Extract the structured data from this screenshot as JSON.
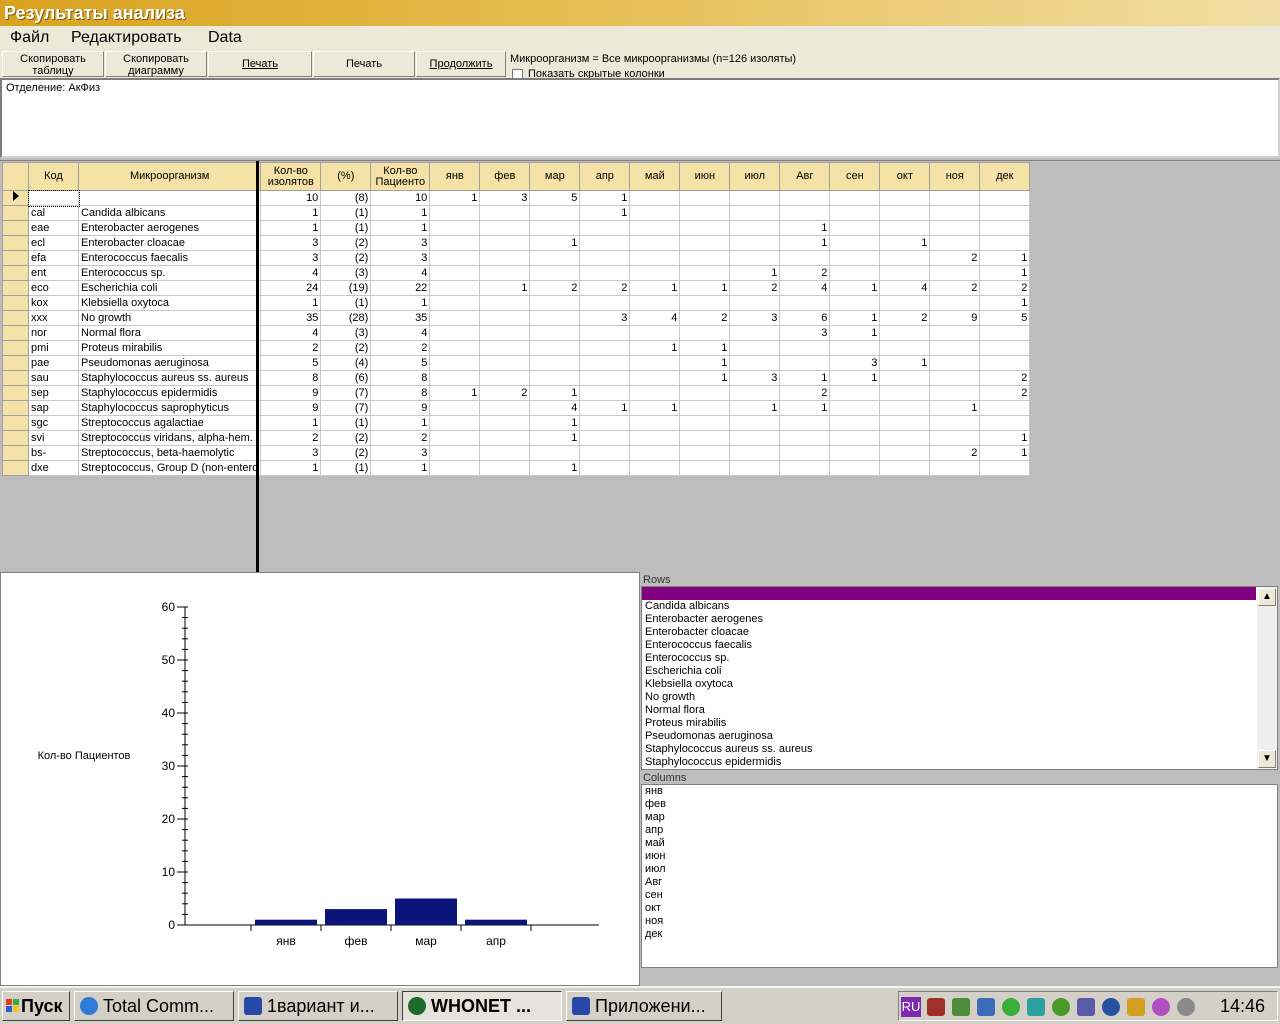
{
  "window": {
    "title": "Результаты анализа"
  },
  "menu": [
    "Файл",
    "Редактировать",
    "Data"
  ],
  "toolbar": {
    "copy_table": [
      "Скопировать",
      "таблицу"
    ],
    "copy_chart": [
      "Скопировать",
      "диаграмму"
    ],
    "print1": "Печать",
    "print2": "Печать",
    "continue": "Продолжить",
    "filter_info": "Микроорганизм = Все микроорганизмы   (n=126 изоляты)",
    "show_hidden_label": "Показать скрытые колонки",
    "show_hidden_checked": false
  },
  "department": "Отделение:   АкФиз",
  "table": {
    "headers": [
      "Код",
      "Микроорганизм",
      "Кол-во изолятов",
      "(%)",
      "Кол-во Пациенто",
      "янв",
      "фев",
      "мар",
      "апр",
      "май",
      "июн",
      "июл",
      "Авг",
      "сен",
      "окт",
      "ноя",
      "дек"
    ],
    "rows": [
      [
        "",
        "",
        "10",
        "(8)",
        "10",
        "1",
        "3",
        "5",
        "1",
        "",
        "",
        "",
        "",
        "",
        "",
        "",
        ""
      ],
      [
        "cal",
        "Candida albicans",
        "1",
        "(1)",
        "1",
        "",
        "",
        "",
        "1",
        "",
        "",
        "",
        "",
        "",
        "",
        "",
        ""
      ],
      [
        "eae",
        "Enterobacter aerogenes",
        "1",
        "(1)",
        "1",
        "",
        "",
        "",
        "",
        "",
        "",
        "",
        "1",
        "",
        "",
        "",
        ""
      ],
      [
        "ecl",
        "Enterobacter cloacae",
        "3",
        "(2)",
        "3",
        "",
        "",
        "1",
        "",
        "",
        "",
        "",
        "1",
        "",
        "1",
        "",
        ""
      ],
      [
        "efa",
        "Enterococcus faecalis",
        "3",
        "(2)",
        "3",
        "",
        "",
        "",
        "",
        "",
        "",
        "",
        "",
        "",
        "",
        "2",
        "1"
      ],
      [
        "ent",
        "Enterococcus sp.",
        "4",
        "(3)",
        "4",
        "",
        "",
        "",
        "",
        "",
        "",
        "1",
        "2",
        "",
        "",
        "",
        "1"
      ],
      [
        "eco",
        "Escherichia coli",
        "24",
        "(19)",
        "22",
        "",
        "1",
        "2",
        "2",
        "1",
        "1",
        "2",
        "4",
        "1",
        "4",
        "2",
        "2"
      ],
      [
        "kox",
        "Klebsiella oxytoca",
        "1",
        "(1)",
        "1",
        "",
        "",
        "",
        "",
        "",
        "",
        "",
        "",
        "",
        "",
        "",
        "1"
      ],
      [
        "xxx",
        "No growth",
        "35",
        "(28)",
        "35",
        "",
        "",
        "",
        "3",
        "4",
        "2",
        "3",
        "6",
        "1",
        "2",
        "9",
        "5"
      ],
      [
        "nor",
        "Normal flora",
        "4",
        "(3)",
        "4",
        "",
        "",
        "",
        "",
        "",
        "",
        "",
        "3",
        "1",
        "",
        "",
        ""
      ],
      [
        "pmi",
        "Proteus mirabilis",
        "2",
        "(2)",
        "2",
        "",
        "",
        "",
        "",
        "1",
        "1",
        "",
        "",
        "",
        "",
        "",
        ""
      ],
      [
        "pae",
        "Pseudomonas aeruginosa",
        "5",
        "(4)",
        "5",
        "",
        "",
        "",
        "",
        "",
        "1",
        "",
        "",
        "3",
        "1",
        "",
        ""
      ],
      [
        "sau",
        "Staphylococcus aureus ss. aureus",
        "8",
        "(6)",
        "8",
        "",
        "",
        "",
        "",
        "",
        "1",
        "3",
        "1",
        "1",
        "",
        "",
        "2"
      ],
      [
        "sep",
        "Staphylococcus epidermidis",
        "9",
        "(7)",
        "8",
        "1",
        "2",
        "1",
        "",
        "",
        "",
        "",
        "2",
        "",
        "",
        "",
        "2"
      ],
      [
        "sap",
        "Staphylococcus saprophyticus",
        "9",
        "(7)",
        "9",
        "",
        "",
        "4",
        "1",
        "1",
        "",
        "1",
        "1",
        "",
        "",
        "1",
        ""
      ],
      [
        "sgc",
        "Streptococcus agalactiae",
        "1",
        "(1)",
        "1",
        "",
        "",
        "1",
        "",
        "",
        "",
        "",
        "",
        "",
        "",
        "",
        ""
      ],
      [
        "svi",
        "Streptococcus viridans, alpha-hem.",
        "2",
        "(2)",
        "2",
        "",
        "",
        "1",
        "",
        "",
        "",
        "",
        "",
        "",
        "",
        "",
        "1"
      ],
      [
        "bs-",
        "Streptococcus, beta-haemolytic",
        "3",
        "(2)",
        "3",
        "",
        "",
        "",
        "",
        "",
        "",
        "",
        "",
        "",
        "",
        "2",
        "1"
      ],
      [
        "dxe",
        "Streptococcus, Group D (non-entero",
        "1",
        "(1)",
        "1",
        "",
        "",
        "1",
        "",
        "",
        "",
        "",
        "",
        "",
        "",
        "",
        ""
      ]
    ]
  },
  "chart_data": {
    "type": "bar",
    "categories": [
      "янв",
      "фев",
      "мар",
      "апр"
    ],
    "values": [
      1,
      3,
      5,
      1
    ],
    "ylabel": "Кол-во Пациентов",
    "ylim": [
      0,
      60
    ],
    "yticks": [
      0,
      10,
      20,
      30,
      40,
      50,
      60
    ],
    "bar_color": "#0a1478"
  },
  "rows_panel": {
    "label": "Rows",
    "items": [
      "Candida albicans",
      "Enterobacter aerogenes",
      "Enterobacter cloacae",
      "Enterococcus faecalis",
      "Enterococcus sp.",
      "Escherichia coli",
      "Klebsiella oxytoca",
      "No growth",
      "Normal flora",
      "Proteus mirabilis",
      "Pseudomonas aeruginosa",
      "Staphylococcus aureus ss. aureus",
      "Staphylococcus epidermidis"
    ]
  },
  "columns_panel": {
    "label": "Columns",
    "items": [
      "янв",
      "фев",
      "мар",
      "апр",
      "май",
      "июн",
      "июл",
      "Авг",
      "сен",
      "окт",
      "ноя",
      "дек"
    ]
  },
  "taskbar": {
    "start": "Пуск",
    "tasks": [
      {
        "label": "Total Comm...",
        "active": false
      },
      {
        "label": "1вариант  и...",
        "active": false
      },
      {
        "label": "WHONET ...",
        "active": true
      },
      {
        "label": "Приложени...",
        "active": false
      }
    ],
    "lang": "RU",
    "clock": "14:46"
  }
}
